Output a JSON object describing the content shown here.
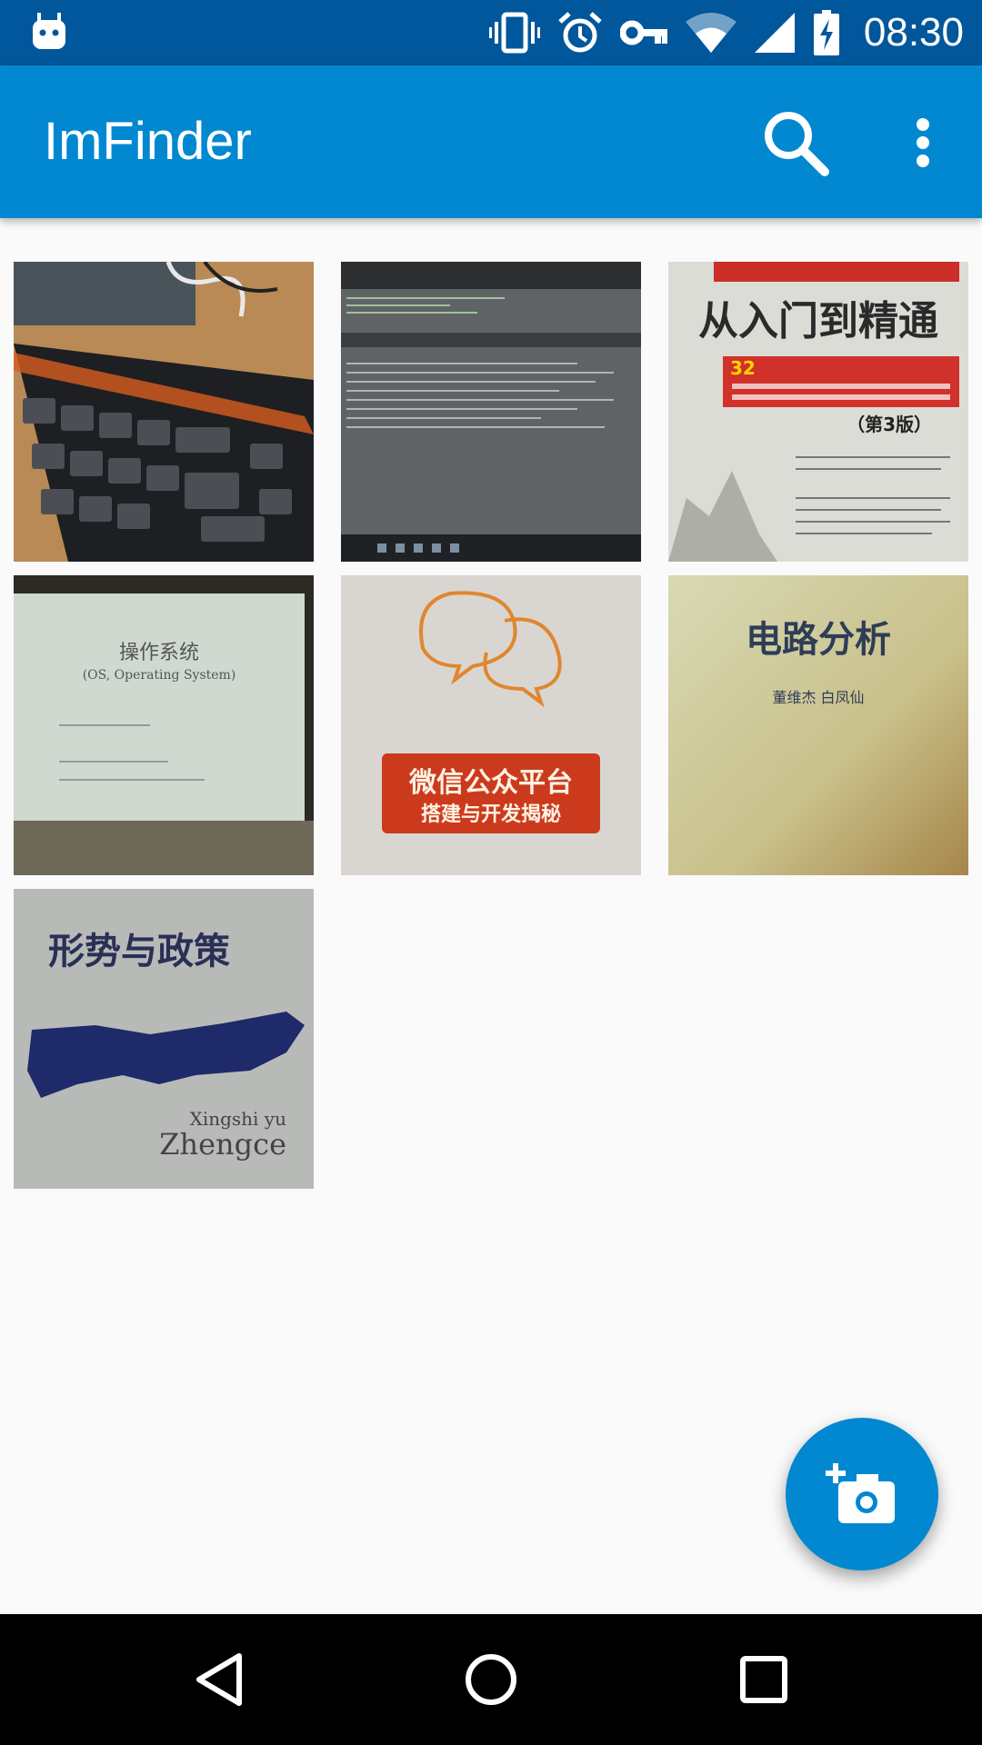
{
  "status_bar": {
    "time": "08:30",
    "icons": [
      "android-icon",
      "vibrate-icon",
      "alarm-icon",
      "vpn-key-icon",
      "wifi-icon",
      "cell-signal-icon",
      "battery-charging-icon"
    ]
  },
  "app_bar": {
    "title": "ImFinder",
    "actions": [
      "search-icon",
      "more-vert-icon"
    ]
  },
  "gallery": {
    "thumbnails": [
      {
        "name": "keyboard-photo",
        "description_icon": "photo"
      },
      {
        "name": "code-screen-photo",
        "description_icon": "photo"
      },
      {
        "name": "java-book-photo",
        "text": "从入门到精通",
        "badge": "32",
        "edition": "（第3版）"
      },
      {
        "name": "os-slide-photo",
        "text": "操作系统",
        "subtitle": "(OS, Operating System)"
      },
      {
        "name": "wechat-book-photo",
        "text": "微信公众平台",
        "subtitle": "搭建与开发揭秘"
      },
      {
        "name": "circuit-book-photo",
        "text": "电路分析",
        "subtitle": "董维杰  白凤仙"
      },
      {
        "name": "policy-book-photo",
        "text": "形势与政策",
        "subtitle": "Xingshi yu",
        "subtitle2": "Zhengce"
      }
    ]
  },
  "fab": {
    "icon": "add-a-photo-icon"
  },
  "nav_bar": {
    "buttons": [
      "back-icon",
      "home-icon",
      "recents-icon"
    ]
  },
  "colors": {
    "status_bar": "#01579b",
    "app_bar": "#0288d1",
    "accent": "#0288d1",
    "background": "#fafafa",
    "nav_bar": "#000000"
  }
}
